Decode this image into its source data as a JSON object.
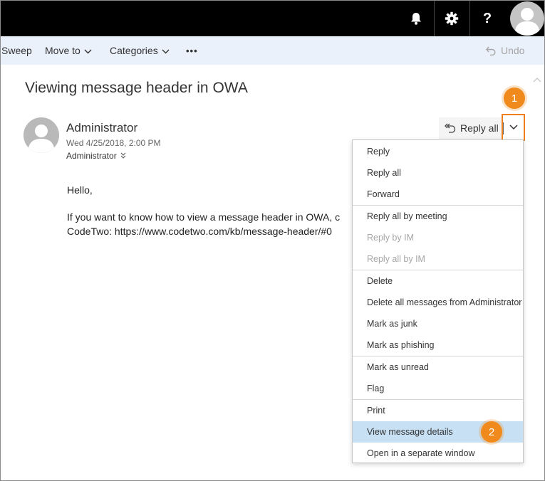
{
  "topbar": {
    "icons": [
      "bell-icon",
      "gear-icon",
      "help-icon",
      "avatar"
    ],
    "help_glyph": "?"
  },
  "toolbar": {
    "sweep": "Sweep",
    "move_to": "Move to",
    "categories": "Categories",
    "more": "•••",
    "undo": "Undo"
  },
  "message": {
    "subject": "Viewing message header in OWA",
    "sender": "Administrator",
    "date": "Wed 4/25/2018, 2:00 PM",
    "to": "Administrator",
    "body_greeting": "Hello,",
    "body_line1": "If you want to know how to view a message header in OWA, c",
    "body_line2": "CodeTwo: https://www.codetwo.com/kb/message-header/#0"
  },
  "reply_all": {
    "label": "Reply all"
  },
  "callouts": {
    "one": "1",
    "two": "2"
  },
  "menu": {
    "items": [
      {
        "label": "Reply",
        "disabled": false
      },
      {
        "label": "Reply all",
        "disabled": false
      },
      {
        "label": "Forward",
        "disabled": false
      },
      {
        "label": "Reply all by meeting",
        "disabled": false
      },
      {
        "label": "Reply by IM",
        "disabled": true
      },
      {
        "label": "Reply all by IM",
        "disabled": true
      },
      {
        "label": "Delete",
        "disabled": false
      },
      {
        "label": "Delete all messages from Administrator",
        "disabled": false
      },
      {
        "label": "Mark as junk",
        "disabled": false
      },
      {
        "label": "Mark as phishing",
        "disabled": false
      },
      {
        "label": "Mark as unread",
        "disabled": false
      },
      {
        "label": "Flag",
        "disabled": false
      },
      {
        "label": "Print",
        "disabled": false
      },
      {
        "label": "View message details",
        "disabled": false,
        "selected": true
      },
      {
        "label": "Open in a separate window",
        "disabled": false
      }
    ]
  },
  "colors": {
    "topbar": "#000000",
    "commandbar": "#eaf1fb",
    "callout": "#f08a1c",
    "highlight": "#c7e0f4"
  }
}
